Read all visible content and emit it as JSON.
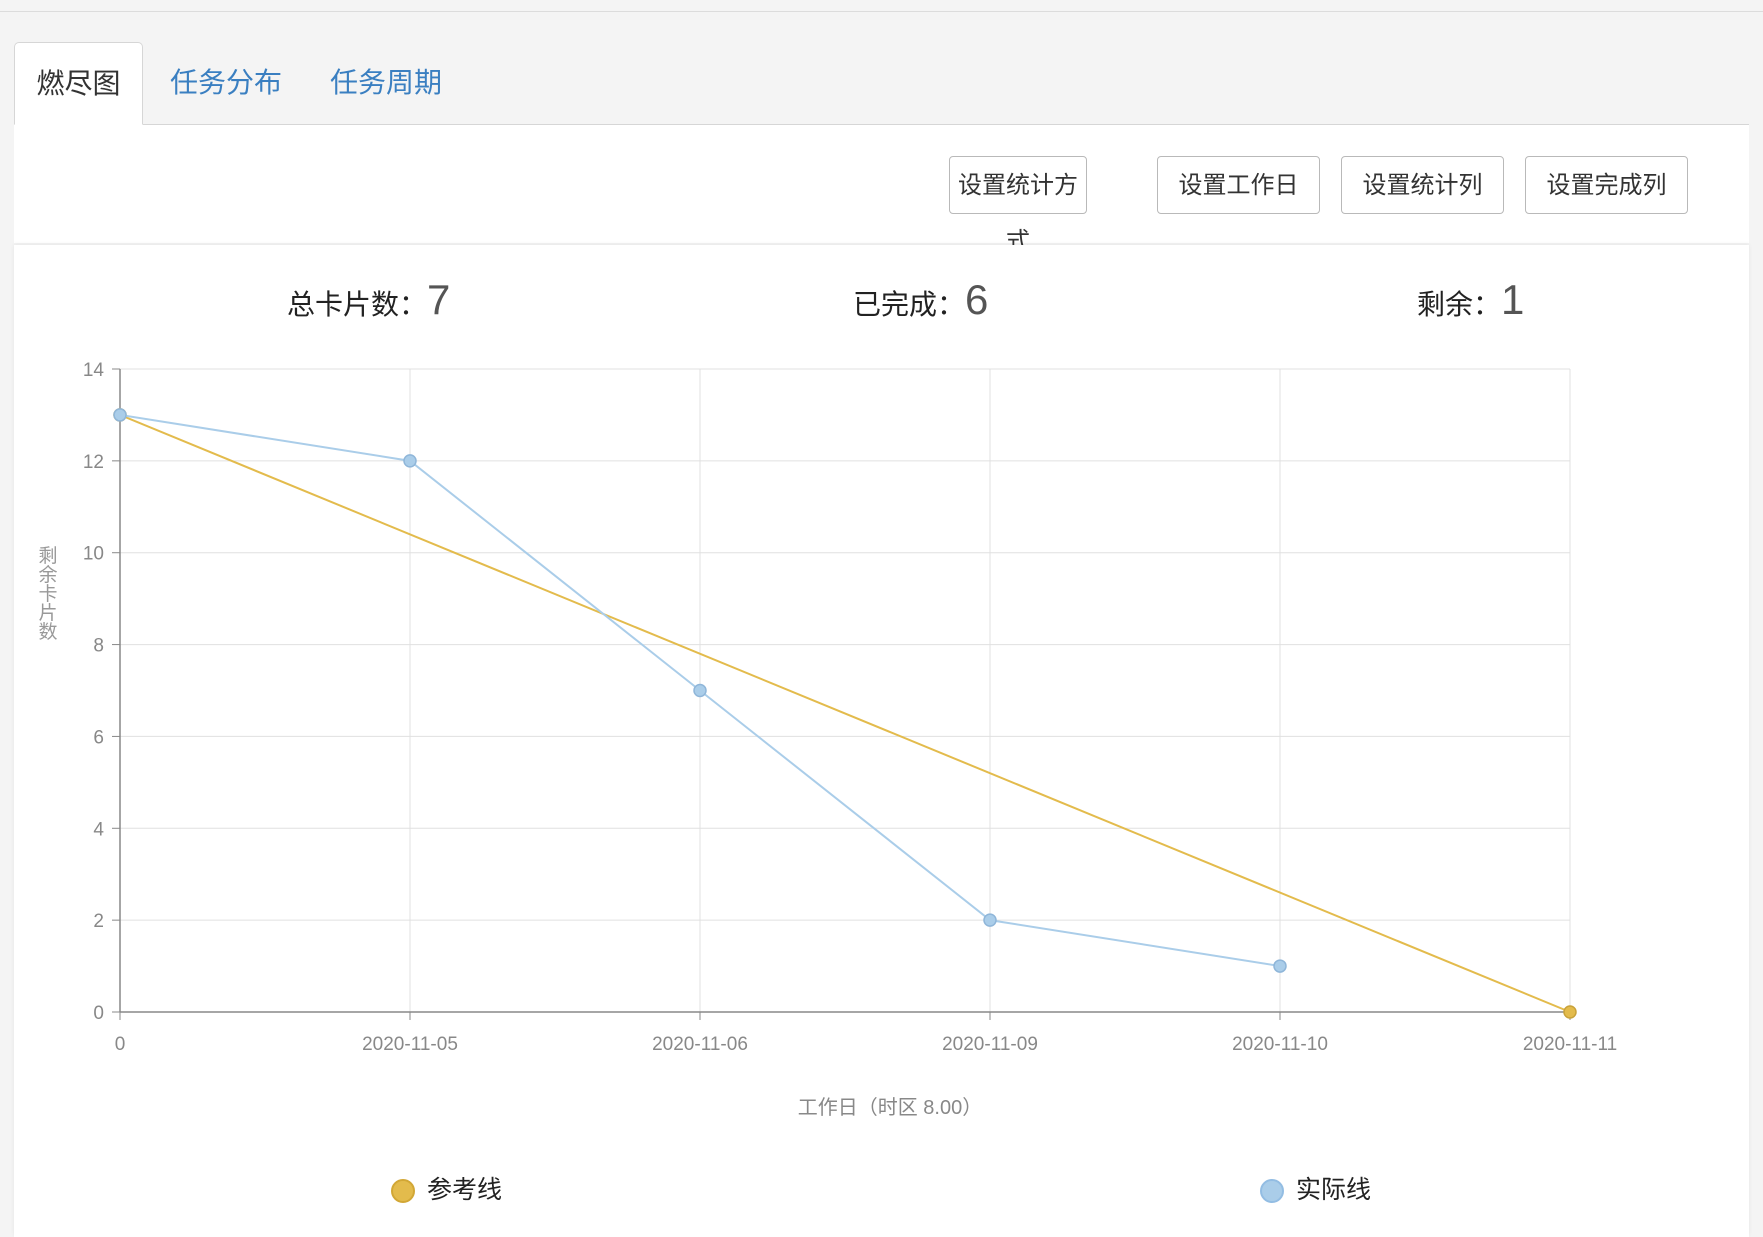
{
  "tabs": [
    {
      "label": "燃尽图",
      "active": true
    },
    {
      "label": "任务分布",
      "active": false
    },
    {
      "label": "任务周期",
      "active": false
    }
  ],
  "toolbar": {
    "buttons": [
      "设置统计方式",
      "设置工作日",
      "设置统计列",
      "设置完成列"
    ]
  },
  "stats": {
    "total_label": "总卡片数：",
    "total_value": "7",
    "done_label": "已完成：",
    "done_value": "6",
    "remain_label": "剩余：",
    "remain_value": "1"
  },
  "colors": {
    "reference": "#e3bb4c",
    "actual": "#aacde9",
    "grid": "#e0e0e0",
    "axis": "#888888"
  },
  "chart_data": {
    "type": "line",
    "categories": [
      "0",
      "2020-11-05",
      "2020-11-06",
      "2020-11-09",
      "2020-11-10",
      "2020-11-11"
    ],
    "series": [
      {
        "name": "参考线",
        "values": [
          13,
          null,
          null,
          null,
          null,
          0
        ]
      },
      {
        "name": "实际线",
        "values": [
          13,
          12,
          7,
          2,
          1,
          null
        ]
      }
    ],
    "xlabel": "工作日（时区 8.00）",
    "ylabel": "剩余卡片数",
    "ylim": [
      0,
      14
    ],
    "yticks": [
      0,
      2,
      4,
      6,
      8,
      10,
      12,
      14
    ],
    "grid": true,
    "legend": "bottom"
  }
}
